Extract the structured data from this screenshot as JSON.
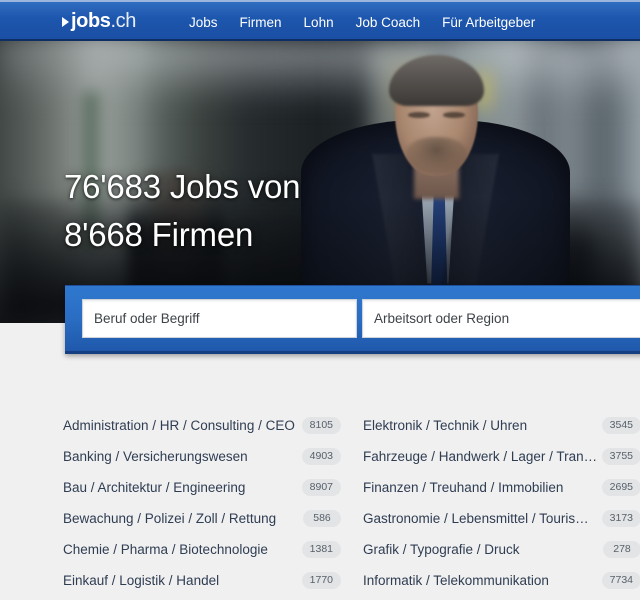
{
  "header": {
    "logo": {
      "triangle": "play-triangle",
      "main": "jobs",
      "suffix": ".ch"
    },
    "nav": [
      {
        "label": "Jobs"
      },
      {
        "label": "Firmen"
      },
      {
        "label": "Lohn"
      },
      {
        "label": "Job Coach"
      },
      {
        "label": "Für Arbeitgeber"
      }
    ],
    "bg_color": "#1d56ad"
  },
  "hero": {
    "line1": "76'683 Jobs von",
    "line2": "8'668 Firmen",
    "jobs_count": "76'683",
    "companies_count": "8'668",
    "image_description": "businessman-in-dark-blue-suit-at-train-station"
  },
  "search": {
    "keyword_value": "",
    "keyword_placeholder": "Beruf oder Begriff",
    "location_value": "",
    "location_placeholder": "Arbeitsort oder Region",
    "panel_color": "#2a6ec4"
  },
  "categories": {
    "left": [
      {
        "label": "Administration / HR / Consulting / CEO",
        "count": "8105"
      },
      {
        "label": "Banking / Versicherungswesen",
        "count": "4903"
      },
      {
        "label": "Bau / Architektur / Engineering",
        "count": "8907"
      },
      {
        "label": "Bewachung / Polizei / Zoll / Rettung",
        "count": "586"
      },
      {
        "label": "Chemie / Pharma / Biotechnologie",
        "count": "1381"
      },
      {
        "label": "Einkauf / Logistik / Handel",
        "count": "1770"
      }
    ],
    "right": [
      {
        "label": "Elektronik / Technik / Uhren",
        "count": "3545"
      },
      {
        "label": "Fahrzeuge / Handwerk / Lager / Tran…",
        "count": "3755"
      },
      {
        "label": "Finanzen / Treuhand / Immobilien",
        "count": "2695"
      },
      {
        "label": "Gastronomie / Lebensmittel / Touris…",
        "count": "3173"
      },
      {
        "label": "Grafik / Typografie / Druck",
        "count": "278"
      },
      {
        "label": "Informatik / Telekommunikation",
        "count": "7734"
      }
    ]
  }
}
